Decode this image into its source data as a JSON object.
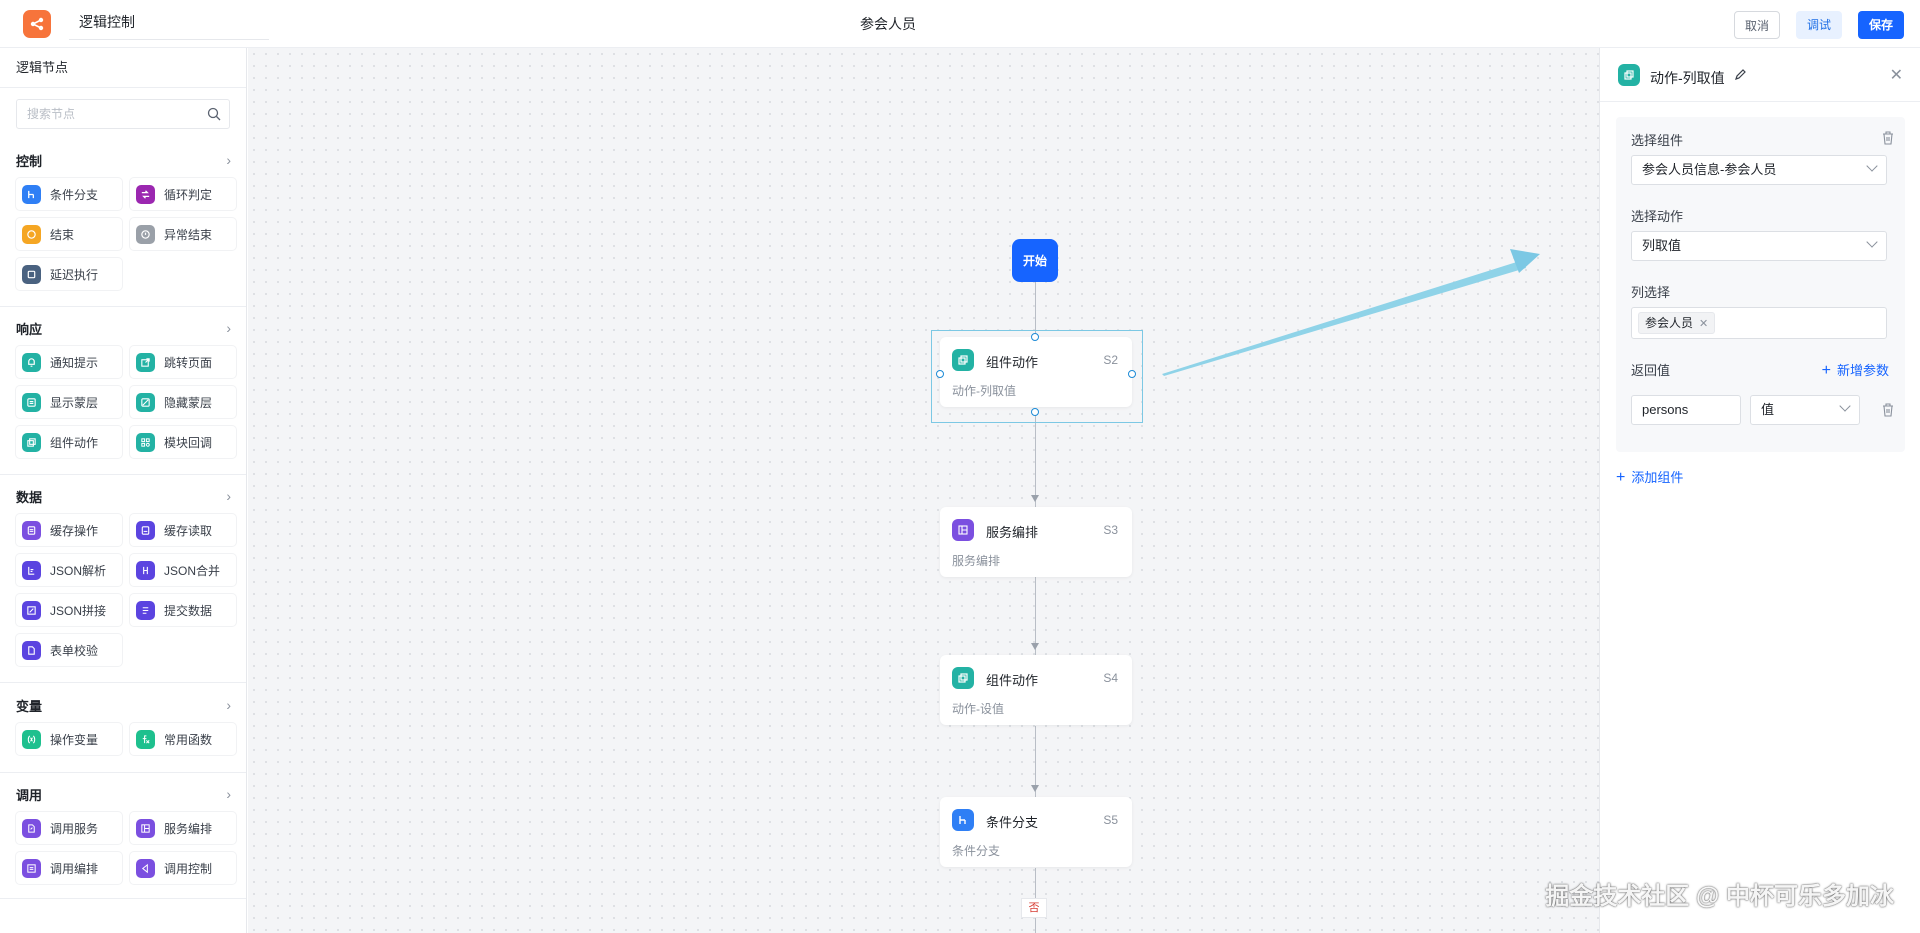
{
  "header": {
    "app_title": "逻辑控制",
    "page_title": "参会人员",
    "cancel_label": "取消",
    "debug_label": "调试",
    "save_label": "保存"
  },
  "sidebar": {
    "title": "逻辑节点",
    "search_placeholder": "搜索节点",
    "groups": [
      {
        "title": "控制",
        "items": [
          {
            "label": "条件分支",
            "color": "#2f7ff5"
          },
          {
            "label": "循环判定",
            "color": "#9b27b0"
          },
          {
            "label": "结束",
            "color": "#f5a623"
          },
          {
            "label": "异常结束",
            "color": "#9aa0a8"
          },
          {
            "label": "延迟执行",
            "color": "#4a6280"
          }
        ]
      },
      {
        "title": "响应",
        "items": [
          {
            "label": "通知提示",
            "color": "#23b2a4"
          },
          {
            "label": "跳转页面",
            "color": "#23b2a4"
          },
          {
            "label": "显示蒙层",
            "color": "#23b2a4"
          },
          {
            "label": "隐藏蒙层",
            "color": "#23b2a4"
          },
          {
            "label": "组件动作",
            "color": "#23b2a4"
          },
          {
            "label": "模块回调",
            "color": "#23b2a4"
          }
        ]
      },
      {
        "title": "数据",
        "items": [
          {
            "label": "缓存操作",
            "color": "#7b4fe0"
          },
          {
            "label": "缓存读取",
            "color": "#5b44e0"
          },
          {
            "label": "JSON解析",
            "color": "#5b44e0"
          },
          {
            "label": "JSON合并",
            "color": "#5b44e0"
          },
          {
            "label": "JSON拼接",
            "color": "#5b44e0"
          },
          {
            "label": "提交数据",
            "color": "#5b44e0"
          },
          {
            "label": "表单校验",
            "color": "#5b44e0"
          }
        ]
      },
      {
        "title": "变量",
        "items": [
          {
            "label": "操作变量",
            "color": "#1ec08e"
          },
          {
            "label": "常用函数",
            "color": "#1ec08e"
          }
        ]
      },
      {
        "title": "调用",
        "items": [
          {
            "label": "调用服务",
            "color": "#7b4fe0"
          },
          {
            "label": "服务编排",
            "color": "#7b4fe0"
          },
          {
            "label": "调用编排",
            "color": "#7b4fe0"
          },
          {
            "label": "调用控制",
            "color": "#7b4fe0"
          }
        ]
      }
    ]
  },
  "canvas": {
    "start_label": "开始",
    "nodes": [
      {
        "title": "组件动作",
        "id": "S2",
        "sub": "动作-列取值",
        "color": "#23b2a4",
        "icon": "component-action-icon"
      },
      {
        "title": "服务编排",
        "id": "S3",
        "sub": "服务编排",
        "color": "#7b4fe0",
        "icon": "service-orchestration-icon"
      },
      {
        "title": "组件动作",
        "id": "S4",
        "sub": "动作-设值",
        "color": "#23b2a4",
        "icon": "component-action-icon"
      },
      {
        "title": "条件分支",
        "id": "S5",
        "sub": "条件分支",
        "color": "#2f7ff5",
        "icon": "condition-branch-icon"
      }
    ],
    "no_label": "否"
  },
  "panel": {
    "title": "动作-列取值",
    "select_component_label": "选择组件",
    "select_component_value": "参会人员信息-参会人员",
    "select_action_label": "选择动作",
    "select_action_value": "列取值",
    "column_select_label": "列选择",
    "column_tag": "参会人员",
    "return_value_label": "返回值",
    "add_param_label": "新增参数",
    "return_name": "persons",
    "return_type": "值",
    "add_component_label": "添加组件"
  },
  "watermark": "掘金技术社区 @ 中杯可乐多加冰"
}
